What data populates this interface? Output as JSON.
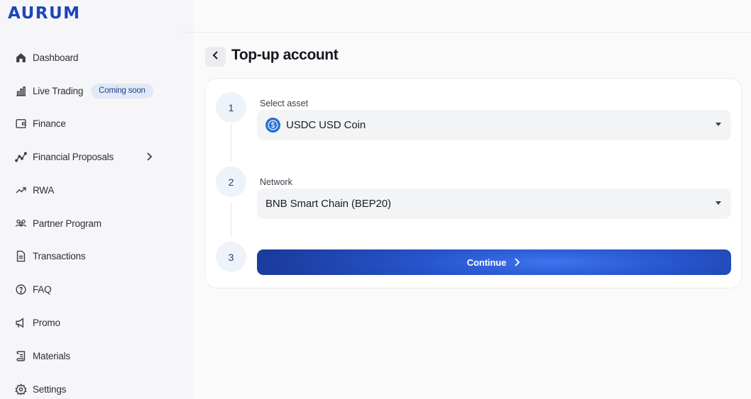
{
  "brand": {
    "logo_text": "AURUM",
    "accent": "#1e46b9"
  },
  "sidebar": {
    "items": [
      {
        "label": "Dashboard",
        "icon": "home-icon"
      },
      {
        "label": "Live Trading",
        "icon": "bar-chart-icon",
        "badge": "Coming soon"
      },
      {
        "label": "Finance",
        "icon": "wallet-icon"
      },
      {
        "label": "Financial Proposals",
        "icon": "line-chart-icon",
        "has_submenu": true
      },
      {
        "label": "RWA",
        "icon": "trending-up-icon"
      },
      {
        "label": "Partner Program",
        "icon": "users-icon"
      },
      {
        "label": "Transactions",
        "icon": "document-icon"
      },
      {
        "label": "FAQ",
        "icon": "question-icon"
      },
      {
        "label": "Promo",
        "icon": "megaphone-icon"
      },
      {
        "label": "Materials",
        "icon": "scroll-icon"
      },
      {
        "label": "Settings",
        "icon": "gear-icon"
      }
    ]
  },
  "main": {
    "title": "Top-up account",
    "steps": [
      {
        "number": "1",
        "label": "Select asset",
        "value": "USDC USD Coin",
        "icon": "usdc-coin-icon"
      },
      {
        "number": "2",
        "label": "Network",
        "value": "BNB Smart Chain (BEP20)"
      },
      {
        "number": "3"
      }
    ],
    "continue_label": "Continue"
  }
}
